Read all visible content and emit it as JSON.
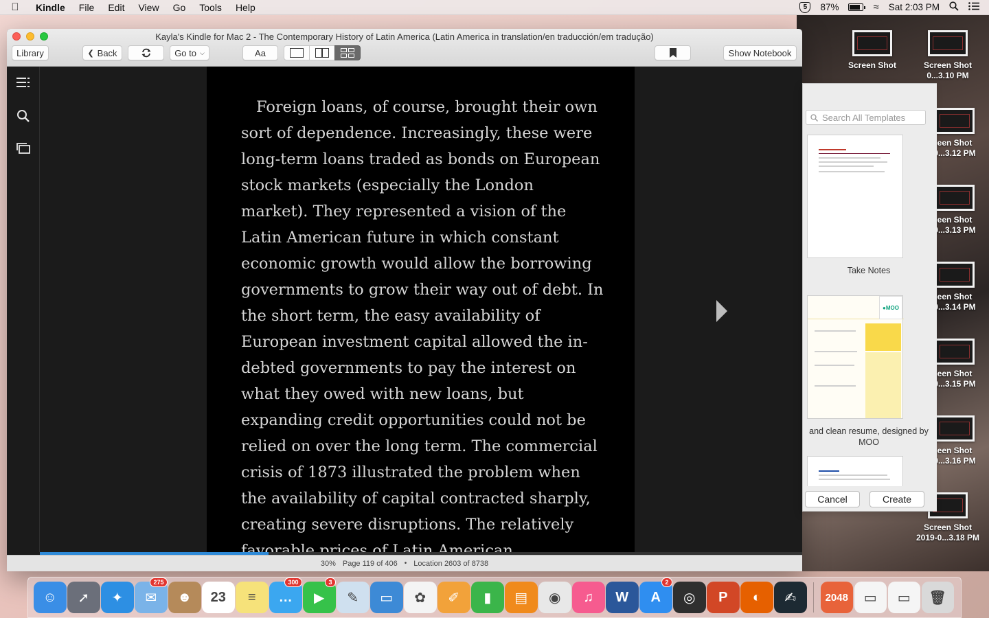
{
  "menubar": {
    "app_name": "Kindle",
    "items": [
      "File",
      "Edit",
      "View",
      "Go",
      "Tools",
      "Help"
    ],
    "battery": "87%",
    "clock": "Sat 2:03 PM"
  },
  "window": {
    "title": "Kayla's Kindle for Mac 2 - The Contemporary History of Latin America (Latin America in translation/en traducción/em tradução)",
    "toolbar": {
      "library": "Library",
      "back": "Back",
      "goto": "Go to",
      "font": "Aa",
      "show_notebook": "Show Notebook"
    }
  },
  "book": {
    "text": "Foreign loans, of course, brought their own sort of dependence. Increasingly, these were long-term loans traded as bonds on European stock markets (especially the London market). They represented a vision of the Latin American future in which constant economic growth would allow the borrowing governments to grow their way out of debt. In the short term, the easy availability of European investment capital allowed the in-debted governments to pay the interest on what they owed with new loans, but expanding credit opportunities could not be relied on over the long term. The commercial crisis of 1873 illustrated the problem when the availability of capital contracted sharply, creating severe disruptions. The relatively favorable prices of Latin American"
  },
  "footer": {
    "percent": "30%",
    "progress_fraction": 0.3,
    "page": "Page 119 of 406",
    "location": "Location 2603 of 8738"
  },
  "templates": {
    "search_placeholder": "Search All Templates",
    "items": [
      {
        "caption": "Take Notes"
      },
      {
        "caption": "and clean resume, designed by MOO"
      }
    ],
    "cancel": "Cancel",
    "create": "Create"
  },
  "desktop": {
    "icons": [
      {
        "label1": "Screen Shot",
        "label2": ""
      },
      {
        "label1": "Screen Shot",
        "label2": "0...3.10 PM"
      },
      {
        "label1": "een Shot",
        "label2": "0...3.12 PM"
      },
      {
        "label1": "een Shot",
        "label2": "0...3.13 PM"
      },
      {
        "label1": "een Shot",
        "label2": "0...3.14 PM"
      },
      {
        "label1": "een Shot",
        "label2": "0...3.15 PM"
      },
      {
        "label1": "een Shot",
        "label2": "0...3.16 PM"
      },
      {
        "label1": "Screen Shot",
        "label2": "2019-0...3.18 PM"
      }
    ]
  },
  "dock": {
    "apps": [
      {
        "name": "finder-icon",
        "bg": "#3a8ee6",
        "glyph": "☺",
        "badge": ""
      },
      {
        "name": "launchpad-icon",
        "bg": "#6b6f7a",
        "glyph": "➚",
        "badge": ""
      },
      {
        "name": "safari-icon",
        "bg": "#2d8fe3",
        "glyph": "✦",
        "badge": ""
      },
      {
        "name": "mail-icon",
        "bg": "#7ab3e8",
        "glyph": "✉",
        "badge": "275"
      },
      {
        "name": "contacts-icon",
        "bg": "#b58a5a",
        "glyph": "☻",
        "badge": ""
      },
      {
        "name": "calendar-icon",
        "bg": "#ffffff",
        "glyph": "23",
        "badge": ""
      },
      {
        "name": "notes-icon",
        "bg": "#f6e27a",
        "glyph": "≡",
        "badge": ""
      },
      {
        "name": "messages-icon",
        "bg": "#3ba7f0",
        "glyph": "…",
        "badge": "300"
      },
      {
        "name": "facetime-icon",
        "bg": "#36c24a",
        "glyph": "▶",
        "badge": "3"
      },
      {
        "name": "preview-icon",
        "bg": "#cfe0ef",
        "glyph": "✎",
        "badge": ""
      },
      {
        "name": "keynote-icon",
        "bg": "#3d8ad6",
        "glyph": "▭",
        "badge": ""
      },
      {
        "name": "photos-icon",
        "bg": "#f4f4f4",
        "glyph": "✿",
        "badge": ""
      },
      {
        "name": "pages-icon",
        "bg": "#f2a23a",
        "glyph": "✐",
        "badge": ""
      },
      {
        "name": "numbers-icon",
        "bg": "#3bb54a",
        "glyph": "▮",
        "badge": ""
      },
      {
        "name": "ibooks-icon",
        "bg": "#f08a1c",
        "glyph": "▤",
        "badge": ""
      },
      {
        "name": "chrome-icon",
        "bg": "#e8e8e8",
        "glyph": "◉",
        "badge": ""
      },
      {
        "name": "itunes-icon",
        "bg": "#f65b8f",
        "glyph": "♫",
        "badge": ""
      },
      {
        "name": "word-icon",
        "bg": "#2b579a",
        "glyph": "W",
        "badge": ""
      },
      {
        "name": "app-store-icon",
        "bg": "#2f8ef0",
        "glyph": "A",
        "badge": "2"
      },
      {
        "name": "screenshot-tool-icon",
        "bg": "#2f2f2f",
        "glyph": "◎",
        "badge": ""
      },
      {
        "name": "powerpoint-icon",
        "bg": "#d24726",
        "glyph": "P",
        "badge": ""
      },
      {
        "name": "firefox-icon",
        "bg": "#e66000",
        "glyph": "◐",
        "badge": ""
      },
      {
        "name": "kindle-icon",
        "bg": "#1d2a33",
        "glyph": "✍",
        "badge": ""
      },
      {
        "name": "2048-icon",
        "bg": "#e8633a",
        "glyph": "2048",
        "badge": ""
      },
      {
        "name": "chrome-doc-icon",
        "bg": "#f5f5f5",
        "glyph": "▭",
        "badge": ""
      },
      {
        "name": "chrome-doc-icon-2",
        "bg": "#f5f5f5",
        "glyph": "▭",
        "badge": ""
      },
      {
        "name": "trash-icon",
        "bg": "#d9d9d9",
        "glyph": "🗑",
        "badge": ""
      }
    ]
  }
}
